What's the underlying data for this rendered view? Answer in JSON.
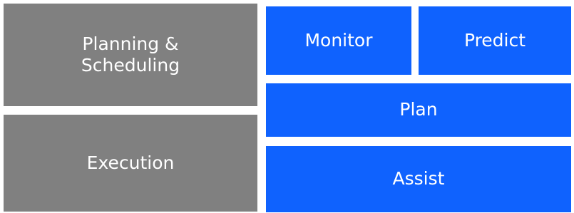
{
  "left_column": {
    "planning_scheduling": "Planning &\nScheduling",
    "execution": "Execution"
  },
  "right_column": {
    "monitor": "Monitor",
    "predict": "Predict",
    "plan": "Plan",
    "assist": "Assist"
  },
  "colors": {
    "gray_block": "#808080",
    "blue_block": "#0f62fe",
    "text": "#ffffff"
  }
}
